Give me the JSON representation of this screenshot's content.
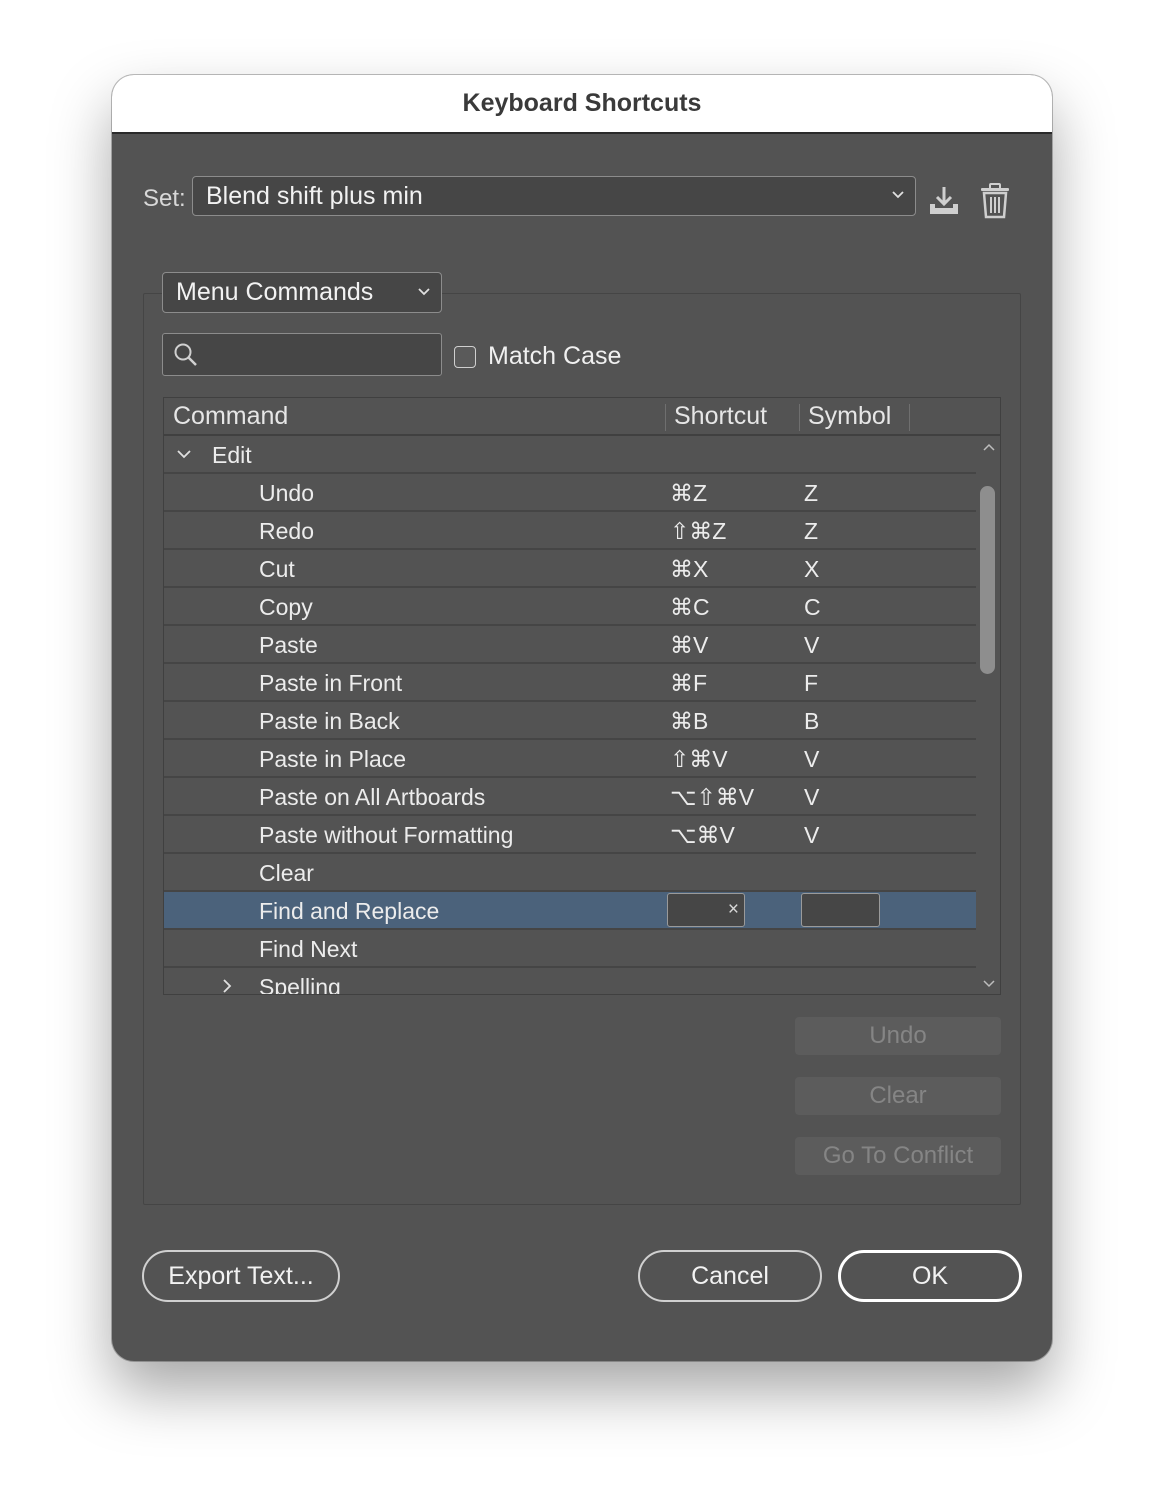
{
  "window": {
    "title": "Keyboard Shortcuts"
  },
  "set": {
    "label": "Set:",
    "value": "Blend shift plus min"
  },
  "category": {
    "value": "Menu Commands"
  },
  "search": {
    "placeholder": "",
    "value": ""
  },
  "match_case": {
    "label": "Match Case",
    "checked": false
  },
  "table": {
    "columns": {
      "command": "Command",
      "shortcut": "Shortcut",
      "symbol": "Symbol"
    },
    "group": "Edit",
    "rows": [
      {
        "command": "Undo",
        "shortcut": "⌘Z",
        "symbol": "Z"
      },
      {
        "command": "Redo",
        "shortcut": "⇧⌘Z",
        "symbol": "Z"
      },
      {
        "command": "Cut",
        "shortcut": "⌘X",
        "symbol": "X"
      },
      {
        "command": "Copy",
        "shortcut": "⌘C",
        "symbol": "C"
      },
      {
        "command": "Paste",
        "shortcut": "⌘V",
        "symbol": "V"
      },
      {
        "command": "Paste in Front",
        "shortcut": "⌘F",
        "symbol": "F"
      },
      {
        "command": "Paste in Back",
        "shortcut": "⌘B",
        "symbol": "B"
      },
      {
        "command": "Paste in Place",
        "shortcut": "⇧⌘V",
        "symbol": "V"
      },
      {
        "command": "Paste on All Artboards",
        "shortcut": "⌥⇧⌘V",
        "symbol": "V"
      },
      {
        "command": "Paste without Formatting",
        "shortcut": "⌥⌘V",
        "symbol": "V"
      },
      {
        "command": "Clear",
        "shortcut": "",
        "symbol": ""
      },
      {
        "command": "Find and Replace",
        "shortcut": "",
        "symbol": ""
      },
      {
        "command": "Find Next",
        "shortcut": "",
        "symbol": ""
      }
    ],
    "selected_row": "Find and Replace",
    "subgroup": "Spelling",
    "clear_x": "×"
  },
  "buttons": {
    "undo": "Undo",
    "clear": "Clear",
    "go_to_conflict": "Go To Conflict",
    "export_text": "Export Text...",
    "cancel": "Cancel",
    "ok": "OK"
  },
  "colors": {
    "dialog_bg": "#535353",
    "selection": "#4b627b",
    "title_bar": "#ffffff"
  }
}
